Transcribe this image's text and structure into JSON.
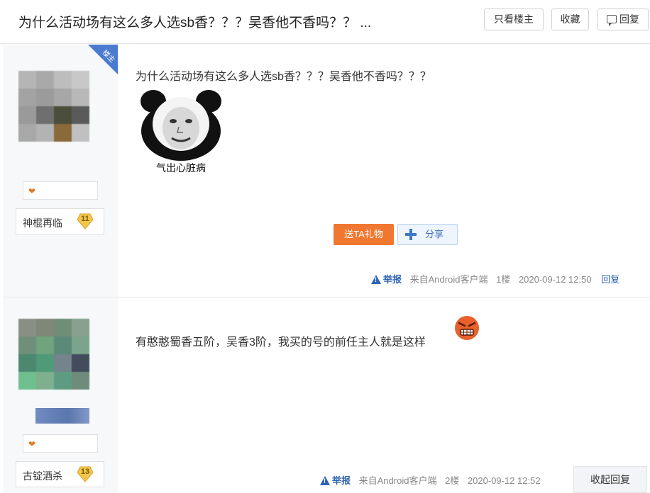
{
  "header": {
    "title": "为什么活动场有这么多人选sb香？？？吴香他不香吗？？ ...",
    "only_op_label": "只看楼主",
    "favorite_label": "收藏",
    "reply_label": "回复"
  },
  "posts": [
    {
      "op_badge": "楼主",
      "username": "神棍再临",
      "level": "11",
      "content": "为什么活动场有这么多人选sb香？？？吴香他不香吗？？？",
      "meme_caption": "气出心脏病",
      "gift_label": "送TA礼物",
      "share_label": "分享",
      "report_label": "举报",
      "source": "来自Android客户端",
      "floor": "1楼",
      "time": "2020-09-12 12:50",
      "reply_label": "回复"
    },
    {
      "username": "古锭酒杀",
      "level": "13",
      "content": "有憨憨蜀香五阶，吴香3阶，我买的号的前任主人就是这样",
      "report_label": "举报",
      "source": "来自Android客户端",
      "floor": "2楼",
      "time": "2020-09-12 12:52",
      "collapse_label": "收起回复"
    }
  ],
  "colors": {
    "accent_blue": "#2d64b3",
    "gift_orange": "#f0772f",
    "op_badge_blue": "#4a7bd0",
    "level_gold": "#f3c64b"
  },
  "icons": [
    "reply-icon",
    "warning-icon",
    "plus-icon",
    "heart-icon",
    "level-badge-icon",
    "angry-emoji-icon"
  ]
}
